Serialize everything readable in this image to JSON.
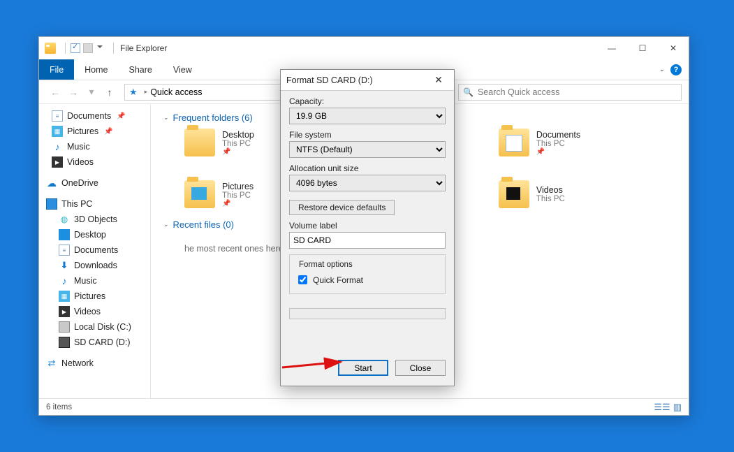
{
  "window": {
    "title": "File Explorer",
    "controls": {
      "min": "—",
      "max": "☐",
      "close": "✕"
    }
  },
  "ribbon": {
    "tabs": {
      "file": "File",
      "home": "Home",
      "share": "Share",
      "view": "View"
    },
    "help": "?"
  },
  "addressbar": {
    "back": "←",
    "forward": "→",
    "dd": "▾",
    "up": "↑",
    "crumb_root": "Quick access",
    "refresh": "↻",
    "search_placeholder": "Search Quick access"
  },
  "nav": {
    "quick": {
      "documents": "Documents",
      "pictures": "Pictures",
      "music": "Music",
      "videos": "Videos"
    },
    "onedrive": "OneDrive",
    "thispc": {
      "label": "This PC",
      "d3": "3D Objects",
      "desktop": "Desktop",
      "documents": "Documents",
      "downloads": "Downloads",
      "music": "Music",
      "pictures": "Pictures",
      "videos": "Videos",
      "localdisk": "Local Disk (C:)",
      "sdcard": "SD CARD (D:)"
    },
    "network": "Network"
  },
  "content": {
    "frequent_header": "Frequent folders (6)",
    "recent_header": "Recent files (0)",
    "recent_msg": "he most recent ones here.",
    "tiles": {
      "desktop": {
        "name": "Desktop",
        "loc": "This PC"
      },
      "pictures": {
        "name": "Pictures",
        "loc": "This PC"
      },
      "documents": {
        "name": "Documents",
        "loc": "This PC"
      },
      "videos": {
        "name": "Videos",
        "loc": "This PC"
      }
    }
  },
  "status": {
    "count": "6 items"
  },
  "dialog": {
    "title": "Format SD CARD (D:)",
    "capacity_label": "Capacity:",
    "capacity_value": "19.9 GB",
    "filesystem_label": "File system",
    "filesystem_value": "NTFS (Default)",
    "alloc_label": "Allocation unit size",
    "alloc_value": "4096 bytes",
    "restore_btn": "Restore device defaults",
    "volume_label": "Volume label",
    "volume_value": "SD CARD",
    "options_legend": "Format options",
    "quickformat_label": "Quick Format",
    "quickformat_checked": true,
    "start_btn": "Start",
    "close_btn": "Close"
  }
}
